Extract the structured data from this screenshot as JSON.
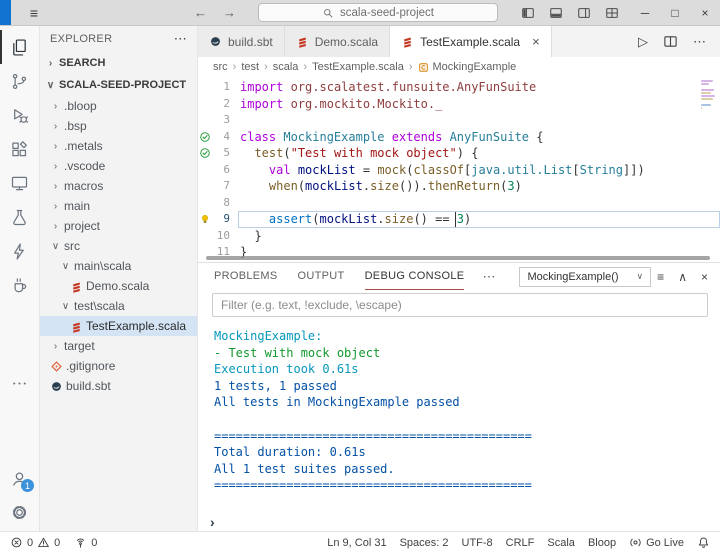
{
  "glyphs": {
    "menu": "≡",
    "back": "←",
    "forward": "→",
    "minimize": "─",
    "maximize": "□",
    "close": "×",
    "dots": "⋯",
    "run": "▷",
    "chev_expanded": "∨",
    "chev_collapsed": "›",
    "chev_up": "∧",
    "dropdown_chev": "∨",
    "prompt": "›",
    "breadcrumb_sep": "›",
    "filter_lines": "≡"
  },
  "colors": {
    "accent": "#1173cf",
    "badge": "#0e7ad3",
    "panel_active_underline": "#a0524a"
  },
  "title_bar": {
    "search_value": "scala-seed-project",
    "layout_icons": [
      "layout-sidebar",
      "layout-panel",
      "layout-sidebar-right",
      "layout-grid"
    ]
  },
  "activity_bar": {
    "top": [
      {
        "name": "explorer",
        "icon": "files",
        "active": true
      },
      {
        "name": "source-control",
        "icon": "scm"
      },
      {
        "name": "run-and-debug",
        "icon": "debug"
      },
      {
        "name": "extensions",
        "icon": "ext"
      },
      {
        "name": "remote-explorer",
        "icon": "remote"
      },
      {
        "name": "testing",
        "icon": "beaker"
      },
      {
        "name": "metals",
        "icon": "bolt"
      },
      {
        "name": "java-packages",
        "icon": "cup"
      },
      {
        "name": "more-views",
        "icon": "more",
        "gap": true
      }
    ],
    "bottom": [
      {
        "name": "accounts",
        "icon": "account",
        "badge": "1"
      },
      {
        "name": "settings",
        "icon": "gear"
      }
    ]
  },
  "sidebar": {
    "header": "EXPLORER",
    "search_label": "SEARCH",
    "project_label": "SCALA-SEED-PROJECT",
    "tree": [
      {
        "label": ".bloop",
        "indent": 0,
        "chevron": ">"
      },
      {
        "label": ".bsp",
        "indent": 0,
        "chevron": ">"
      },
      {
        "label": ".metals",
        "indent": 0,
        "chevron": ">"
      },
      {
        "label": ".vscode",
        "indent": 0,
        "chevron": ">"
      },
      {
        "label": "macros",
        "indent": 0,
        "chevron": ">"
      },
      {
        "label": "main",
        "indent": 0,
        "chevron": ">"
      },
      {
        "label": "project",
        "indent": 0,
        "chevron": ">"
      },
      {
        "label": "src",
        "indent": 0,
        "chevron": "v"
      },
      {
        "label": "main\\scala",
        "indent": 1,
        "chevron": "v"
      },
      {
        "label": "Demo.scala",
        "indent": 2,
        "icon": "scala-file"
      },
      {
        "label": "test\\scala",
        "indent": 1,
        "chevron": "v"
      },
      {
        "label": "TestExample.scala",
        "indent": 2,
        "icon": "scala-file",
        "selected": true
      },
      {
        "label": "target",
        "indent": 0,
        "chevron": ">"
      },
      {
        "label": ".gitignore",
        "indent": 0,
        "icon": "git-file"
      },
      {
        "label": "build.sbt",
        "indent": 0,
        "icon": "sbt-file"
      }
    ]
  },
  "editor": {
    "tabs": [
      {
        "label": "build.sbt",
        "icon": "sbt-file"
      },
      {
        "label": "Demo.scala",
        "icon": "scala-file"
      },
      {
        "label": "TestExample.scala",
        "icon": "scala-file",
        "active": true
      }
    ],
    "breadcrumb": [
      {
        "label": "src"
      },
      {
        "label": "test"
      },
      {
        "label": "scala"
      },
      {
        "label": "TestExample.scala"
      },
      {
        "label": "MockingExample",
        "icon": "class-symbol"
      }
    ],
    "lines": [
      {
        "num": "1",
        "tokens": [
          [
            "kw",
            "import"
          ],
          [
            "pl",
            " "
          ],
          [
            "ns",
            "org.scalatest.funsuite.AnyFunSuite"
          ]
        ]
      },
      {
        "num": "2",
        "tokens": [
          [
            "kw",
            "import"
          ],
          [
            "pl",
            " "
          ],
          [
            "ns",
            "org.mockito.Mockito._"
          ]
        ]
      },
      {
        "num": "3",
        "tokens": []
      },
      {
        "num": "4",
        "gutter": "pass",
        "tokens": [
          [
            "kw",
            "class"
          ],
          [
            "pl",
            " "
          ],
          [
            "type",
            "MockingExample"
          ],
          [
            "pl",
            " "
          ],
          [
            "kw",
            "extends"
          ],
          [
            "pl",
            " "
          ],
          [
            "type",
            "AnyFunSuite"
          ],
          [
            "pl",
            " {"
          ]
        ]
      },
      {
        "num": "5",
        "gutter": "pass",
        "tokens": [
          [
            "pl",
            "  "
          ],
          [
            "fn",
            "test"
          ],
          [
            "pl",
            "("
          ],
          [
            "str",
            "\"Test with mock object\""
          ],
          [
            "pl",
            ") {"
          ]
        ]
      },
      {
        "num": "6",
        "tokens": [
          [
            "pl",
            "    "
          ],
          [
            "kw",
            "val"
          ],
          [
            "pl",
            " "
          ],
          [
            "var",
            "mockList"
          ],
          [
            "pl",
            " = "
          ],
          [
            "fn",
            "mock"
          ],
          [
            "pl",
            "("
          ],
          [
            "fn",
            "classOf"
          ],
          [
            "pl",
            "["
          ],
          [
            "type",
            "java.util.List"
          ],
          [
            "pl",
            "["
          ],
          [
            "type",
            "String"
          ],
          [
            "pl",
            "]])"
          ]
        ]
      },
      {
        "num": "7",
        "tokens": [
          [
            "pl",
            "    "
          ],
          [
            "fn",
            "when"
          ],
          [
            "pl",
            "("
          ],
          [
            "var",
            "mockList"
          ],
          [
            "pl",
            "."
          ],
          [
            "fn",
            "size"
          ],
          [
            "pl",
            "())."
          ],
          [
            "fn",
            "thenReturn"
          ],
          [
            "pl",
            "("
          ],
          [
            "num",
            "3"
          ],
          [
            "pl",
            ")"
          ]
        ]
      },
      {
        "num": "8",
        "tokens": []
      },
      {
        "num": "9",
        "current": true,
        "bulb": true,
        "tokens": [
          [
            "pl",
            "    "
          ],
          [
            "blue",
            "assert"
          ],
          [
            "pl",
            "("
          ],
          [
            "var",
            "mockList"
          ],
          [
            "pl",
            "."
          ],
          [
            "fn",
            "size"
          ],
          [
            "pl",
            "() == "
          ],
          [
            "num",
            "3"
          ],
          [
            "pl",
            ")"
          ]
        ]
      },
      {
        "num": "10",
        "tokens": [
          [
            "pl",
            "  }"
          ]
        ]
      },
      {
        "num": "11",
        "tokens": [
          [
            "pl",
            "}"
          ]
        ]
      }
    ]
  },
  "panel": {
    "tabs": [
      {
        "label": "PROBLEMS"
      },
      {
        "label": "OUTPUT"
      },
      {
        "label": "DEBUG CONSOLE",
        "active": true
      }
    ],
    "dropdown_value": "MockingExample()",
    "filter_placeholder": "Filter (e.g. text, !exclude, \\escape)",
    "console_colors": {
      "cyan": "#0598bc",
      "green": "#14992e",
      "blue": "#0451a5"
    },
    "console": [
      {
        "text": "MockingExample:",
        "color": "cyan"
      },
      {
        "text": "- Test with mock object",
        "color": "green"
      },
      {
        "text": "Execution took 0.61s",
        "color": "cyan"
      },
      {
        "text": "1 tests, 1 passed",
        "color": "blue"
      },
      {
        "text": "All tests in MockingExample passed",
        "color": "blue"
      },
      {
        "text": "",
        "color": "blue"
      },
      {
        "text": "============================================",
        "color": "blue"
      },
      {
        "text": "Total duration: 0.61s",
        "color": "blue"
      },
      {
        "text": "All 1 test suites passed.",
        "color": "blue"
      },
      {
        "text": "============================================",
        "color": "blue"
      }
    ]
  },
  "status_bar": {
    "errors": "0",
    "warnings": "0",
    "ports": "0",
    "items": [
      {
        "label": "Ln 9, Col 31"
      },
      {
        "label": "Spaces: 2"
      },
      {
        "label": "UTF-8"
      },
      {
        "label": "CRLF"
      },
      {
        "label": "Scala"
      },
      {
        "label": "Bloop"
      },
      {
        "label": "Go Live",
        "icon": "golive"
      }
    ]
  }
}
